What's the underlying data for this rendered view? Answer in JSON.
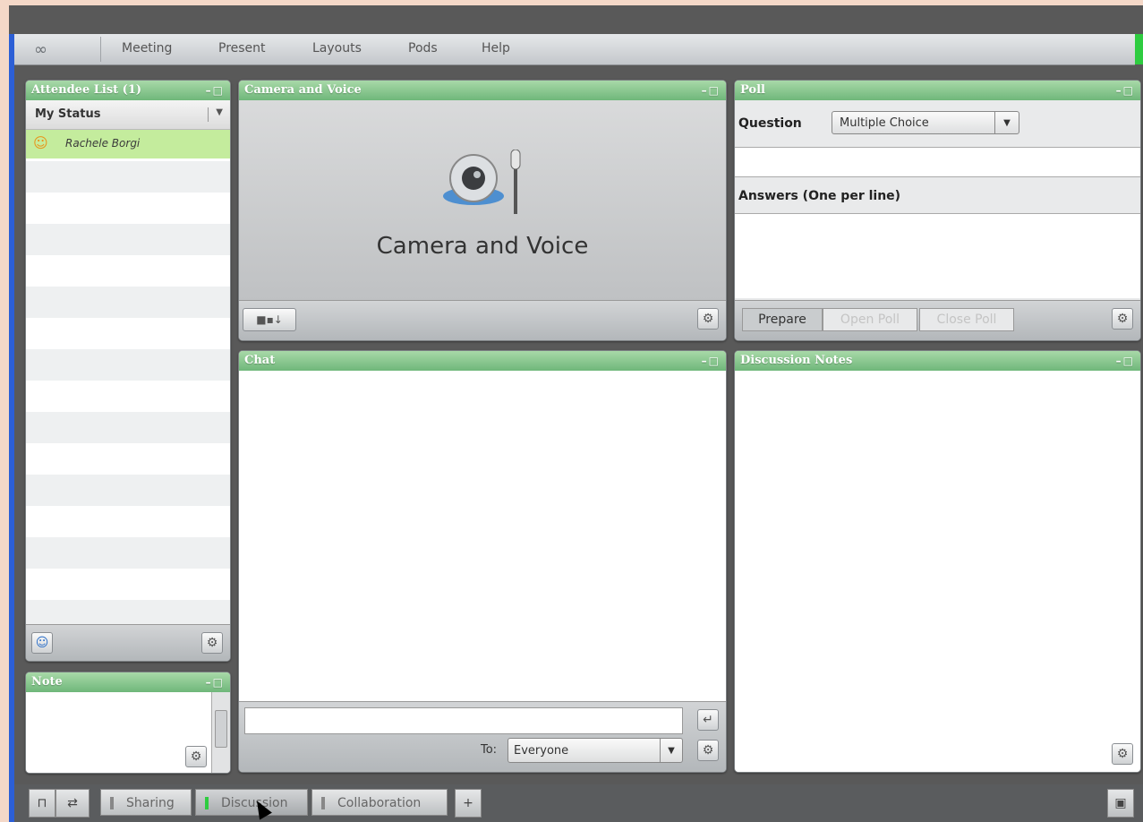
{
  "menu": {
    "logo": "∞",
    "items": [
      "Meeting",
      "Present",
      "Layouts",
      "Pods",
      "Help"
    ]
  },
  "attendee_pod": {
    "title": "Attendee List (1)",
    "window_controls": "–□",
    "status_label": "My Status",
    "attendees": [
      {
        "name": "Rachele Borgi",
        "icon": "host-person-icon"
      }
    ],
    "footer_left_icon": "add-user-icon",
    "footer_gear": "⚙"
  },
  "camera_pod": {
    "title": "Camera and Voice",
    "window_controls": "–□",
    "center_text": "Camera and Voice",
    "footer_left_label": "■▪↓",
    "footer_gear": "⚙"
  },
  "poll_pod": {
    "title": "Poll",
    "window_controls": "–□",
    "question_label": "Question",
    "question_type": "Multiple Choice",
    "answers_label": "Answers (One per line)",
    "buttons": [
      "Prepare",
      "Open Poll",
      "Close Poll"
    ],
    "footer_gear": "⚙"
  },
  "chat_pod": {
    "title": "Chat",
    "window_controls": "–□",
    "send_icon": "↵",
    "to_label": "To:",
    "to_value": "Everyone",
    "footer_gear": "⚙"
  },
  "notes_pod": {
    "title": "Discussion Notes",
    "window_controls": "–□",
    "footer_gear": "⚙"
  },
  "note_pod": {
    "title": "Note",
    "window_controls": "–□",
    "footer_gear": "⚙"
  },
  "bottom_bar": {
    "tabs": [
      "Sharing",
      "Discussion",
      "Collaboration"
    ],
    "active_tab": "Discussion",
    "add_label": "+",
    "left_icons": [
      "lock-icon",
      "shuffle-icon"
    ],
    "right_icon": "save-icon"
  }
}
